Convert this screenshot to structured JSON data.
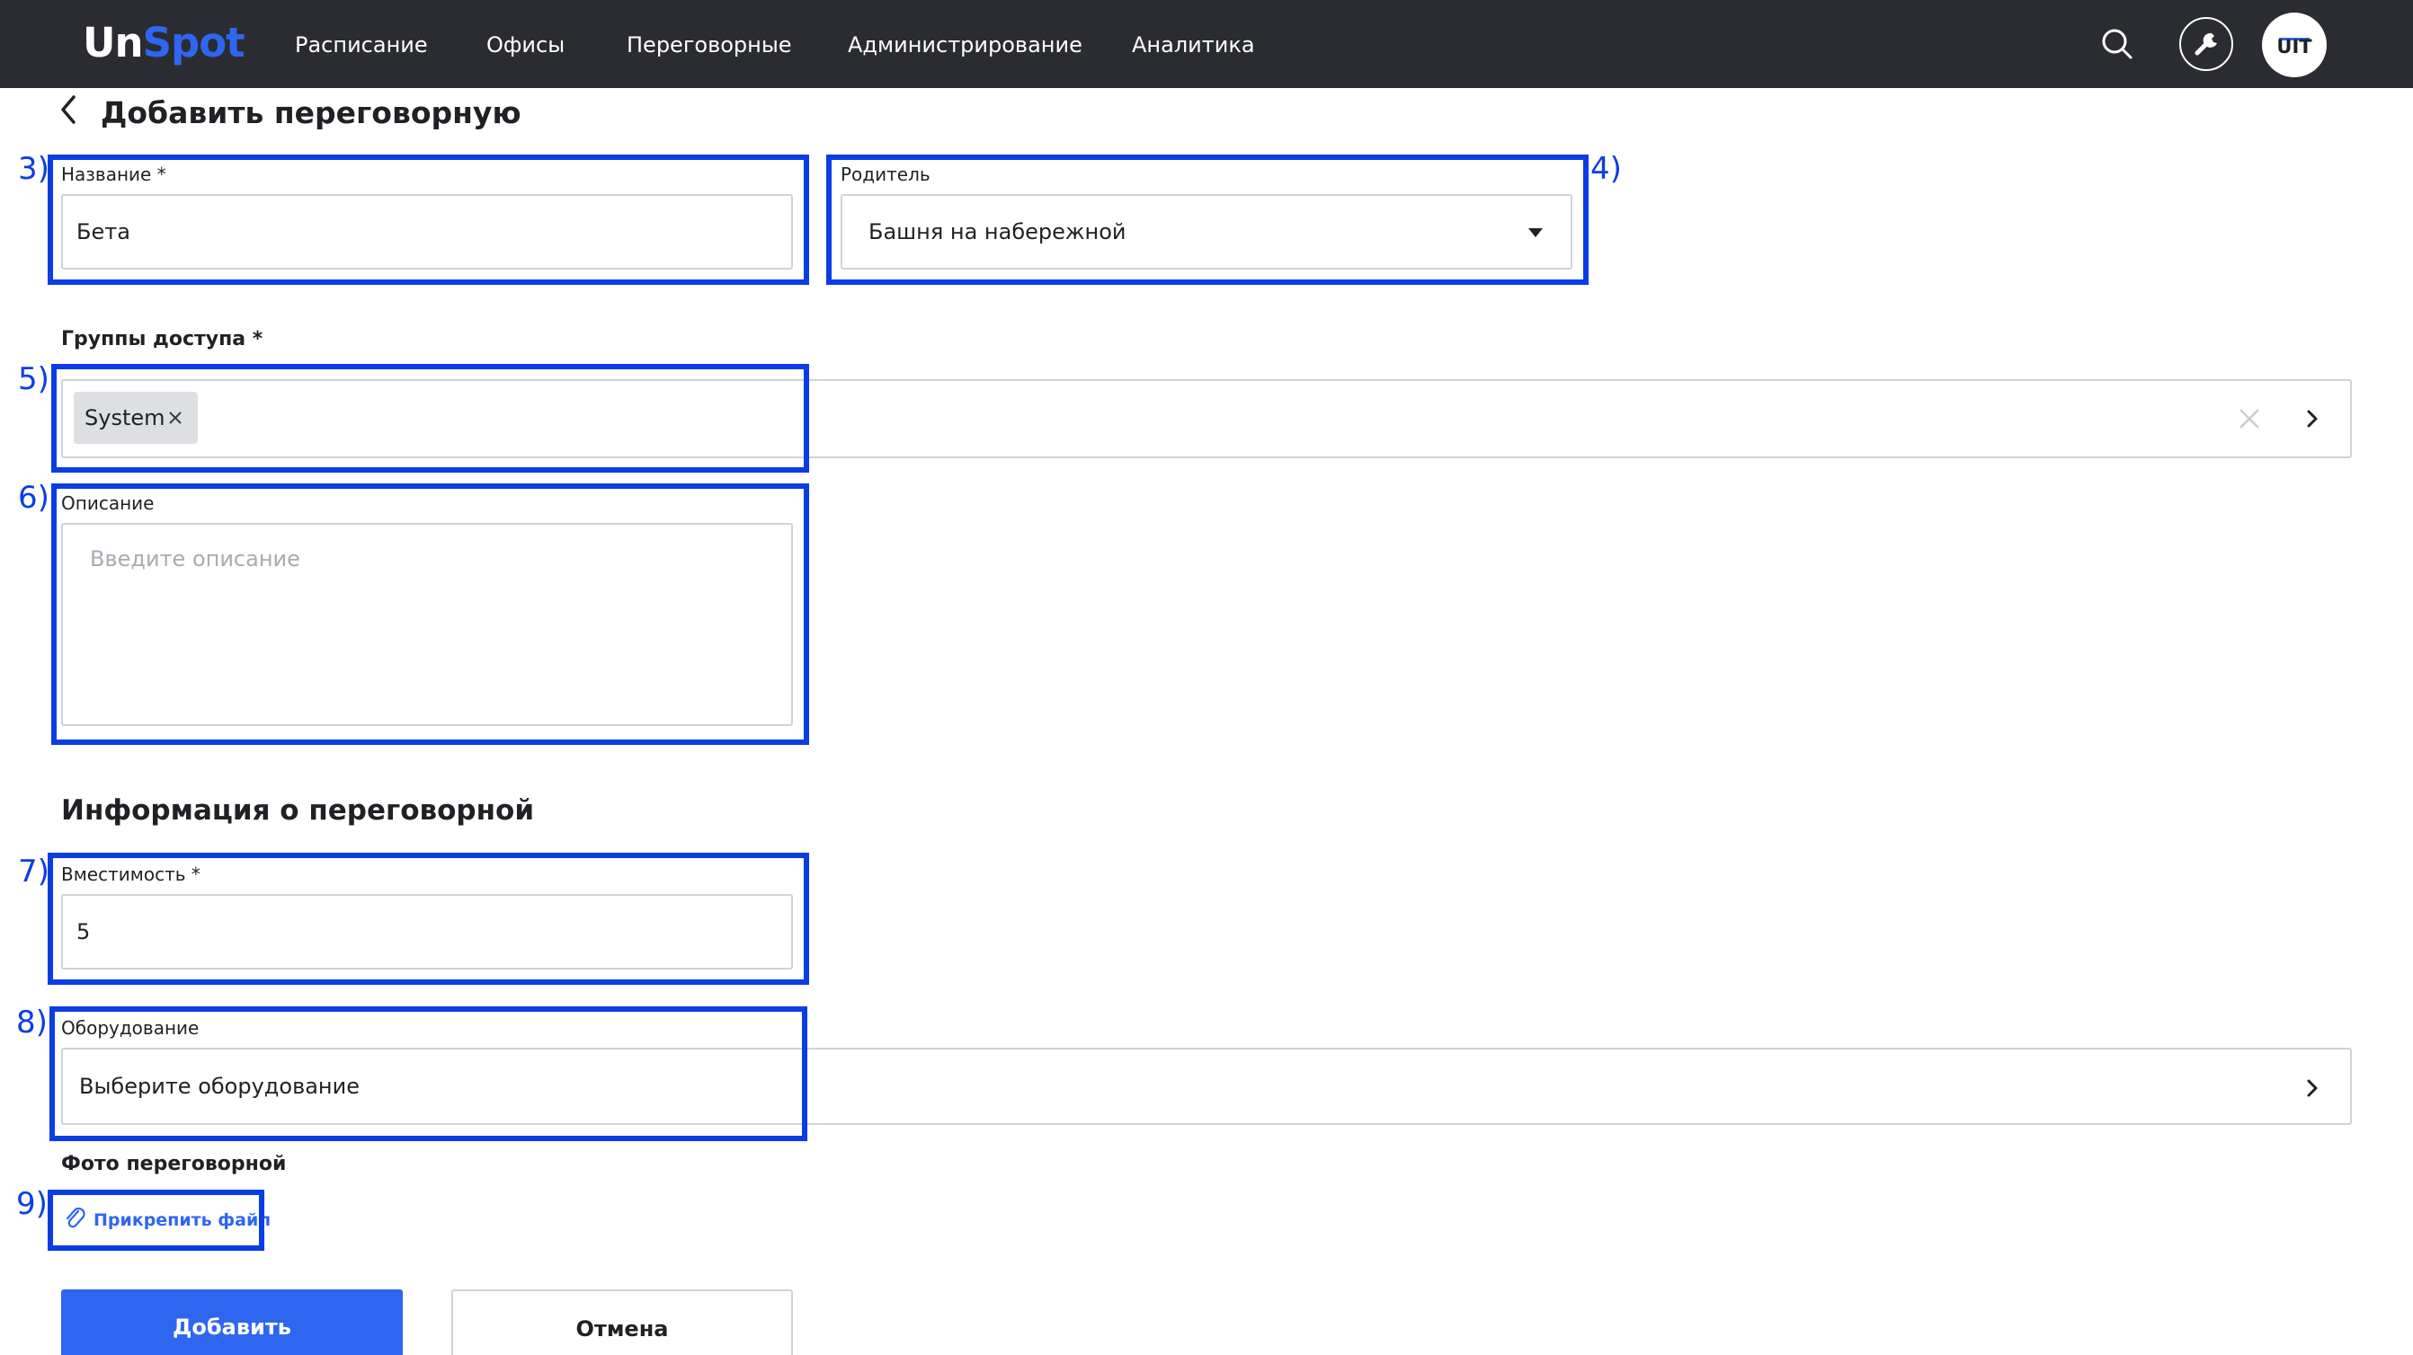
{
  "app": {
    "logo_part1": "Un",
    "logo_part2": "Spot",
    "nav": [
      "Расписание",
      "Офисы",
      "Переговорные",
      "Администрирование",
      "Аналитика"
    ],
    "avatar_initials": "UIT"
  },
  "page": {
    "title": "Добавить переговорную"
  },
  "form": {
    "name": {
      "label": "Название *",
      "value": "Бета"
    },
    "parent": {
      "label": "Родитель",
      "value": "Башня на набережной"
    },
    "access_groups": {
      "label": "Группы доступа *",
      "chips": [
        "System"
      ]
    },
    "description": {
      "label": "Описание",
      "placeholder": "Введите описание"
    },
    "section_title": "Информация о переговорной",
    "capacity": {
      "label": "Вместимость *",
      "value": "5"
    },
    "equipment": {
      "label": "Оборудование",
      "placeholder": "Выберите оборудование"
    },
    "photo": {
      "label": "Фото переговорной",
      "attach_label": "Прикрепить файл"
    },
    "submit_label": "Добавить",
    "cancel_label": "Отмена"
  },
  "annotations": [
    "3)",
    "4)",
    "5)",
    "6)",
    "7)",
    "8)",
    "9)"
  ],
  "colors": {
    "accent": "#2e66f0",
    "topbar": "#2a2c31",
    "annotation": "#0b3de6",
    "field_border": "#cfd2d8",
    "chip_bg": "#dddfe3"
  },
  "icons": {
    "search": "search-icon",
    "tools": "wrench-icon",
    "back": "chevron-left-icon",
    "dropdown": "caret-down-icon",
    "clear": "close-icon",
    "expand": "chevron-right-icon",
    "attach": "paperclip-icon"
  }
}
